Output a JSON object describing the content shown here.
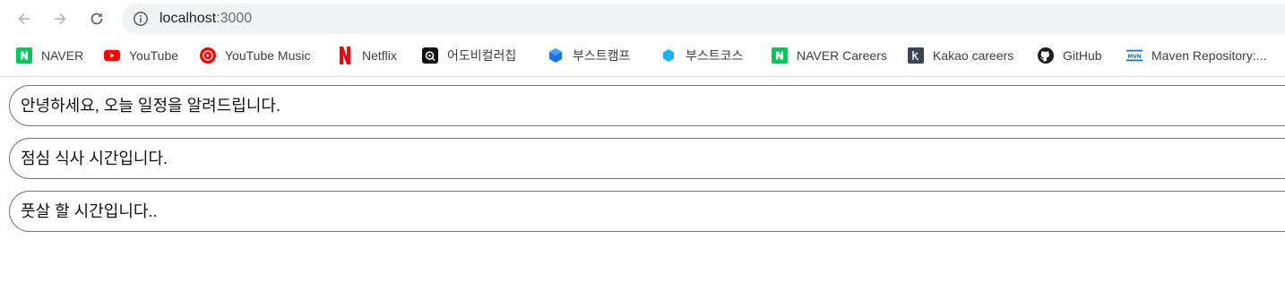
{
  "browser": {
    "url_host": "localhost",
    "url_port": ":3000"
  },
  "bookmarks": [
    {
      "label": "NAVER",
      "icon": "naver-icon"
    },
    {
      "label": "YouTube",
      "icon": "youtube-icon"
    },
    {
      "label": "YouTube Music",
      "icon": "youtube-music-icon"
    },
    {
      "label": "Netflix",
      "icon": "netflix-icon"
    },
    {
      "label": "어도비컬러칩",
      "icon": "adobe-color-icon"
    },
    {
      "label": "부스트캠프",
      "icon": "boostcamp-icon"
    },
    {
      "label": "부스트코스",
      "icon": "boostcourse-icon"
    },
    {
      "label": "NAVER Careers",
      "icon": "naver-icon"
    },
    {
      "label": "Kakao careers",
      "icon": "kakao-icon"
    },
    {
      "label": "GitHub",
      "icon": "github-icon"
    },
    {
      "label": "Maven Repository:...",
      "icon": "maven-icon"
    }
  ],
  "messages": [
    "안녕하세요, 오늘 일정을 알려드립니다.",
    "점심 식사 시간입니다.",
    "풋살 할 시간입니다.."
  ],
  "colors": {
    "naver": "#03c75a",
    "youtube": "#ff0000",
    "netflix": "#e50914",
    "boostcamp": "#1a73e8",
    "boostcourse": "#17b6f0",
    "kakao": "#3b4557",
    "maven": "#1e6fc1"
  }
}
